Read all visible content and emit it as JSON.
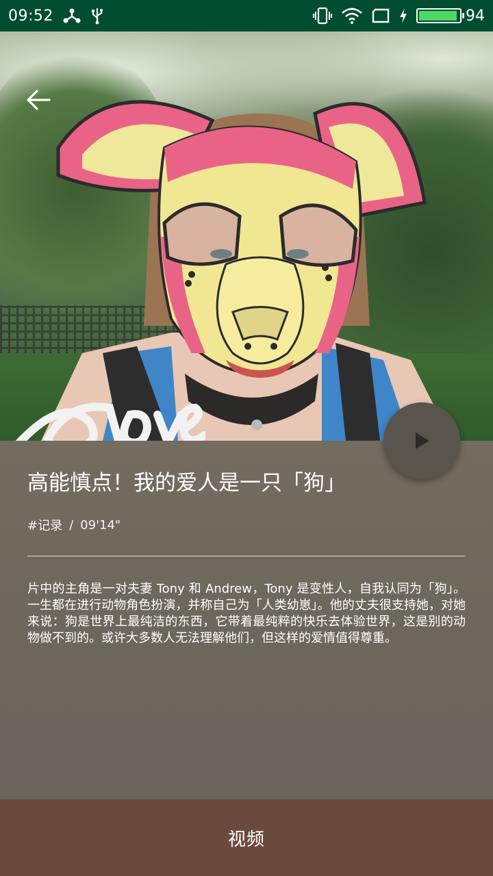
{
  "status_bar": {
    "time": "09:52",
    "battery_level": "94",
    "icons": [
      "network-share-icon",
      "usb-icon",
      "vibrate-icon",
      "wifi-icon",
      "screen-icon",
      "charging-icon",
      "battery-icon"
    ],
    "battery_color": "#4cd964"
  },
  "hero": {
    "back_icon": "arrow-left-icon",
    "play_icon": "play-icon"
  },
  "video": {
    "title": "高能慎点！我的爱人是一只「狗」",
    "tag": "#记录",
    "separator": "/",
    "duration": "09'14\"",
    "description": "片中的主角是一对夫妻 Tony 和 Andrew，Tony 是变性人，自我认同为「狗」。一生都在进行动物角色扮演，并称自己为「人类幼崽」。他的丈夫很支持她，对她来说：狗是世界上最纯洁的东西，它带着最纯粹的快乐去体验世界，这是别的动物做不到的。或许大多数人无法理解他们，但这样的爱情值得尊重。"
  },
  "bottom_bar": {
    "label": "视频",
    "color": "#6b4a3e"
  }
}
